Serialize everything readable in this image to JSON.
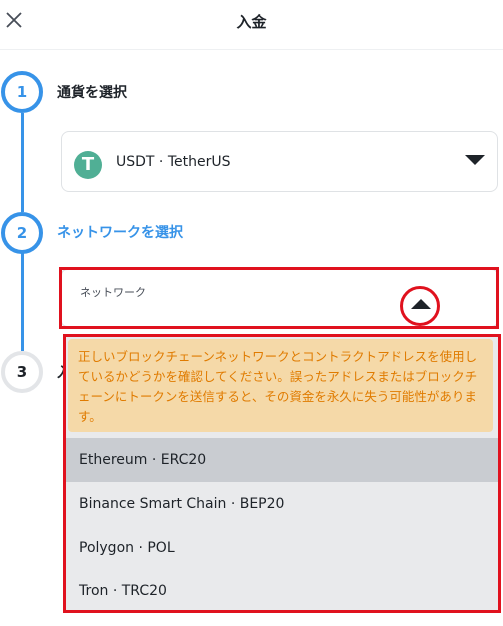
{
  "header": {
    "title": "入金",
    "close_icon": "close-icon"
  },
  "steps": [
    {
      "number": "1",
      "label": "通貨を選択"
    },
    {
      "number": "2",
      "label": "ネットワークを選択"
    },
    {
      "number": "3",
      "label": "入"
    }
  ],
  "currency": {
    "icon": "tether-icon",
    "icon_glyph": "T",
    "value": "USDT · TetherUS"
  },
  "network": {
    "label": "ネットワーク"
  },
  "dropdown": {
    "warning": "正しいブロックチェーンネットワークとコントラクトアドレスを使用しているかどうかを確認してください。誤ったアドレスまたはブロックチェーンにトークンを送信すると、その資金を永久に失う可能性があります。",
    "options": [
      "Ethereum · ERC20",
      "Binance Smart Chain · BEP20",
      "Polygon · POL",
      "Tron · TRC20"
    ]
  },
  "colors": {
    "accent": "#3793e8",
    "highlight": "#e0111e",
    "warning_bg": "#f5d9a8",
    "warning_text": "#e07b00",
    "tether_green": "#50af95"
  }
}
